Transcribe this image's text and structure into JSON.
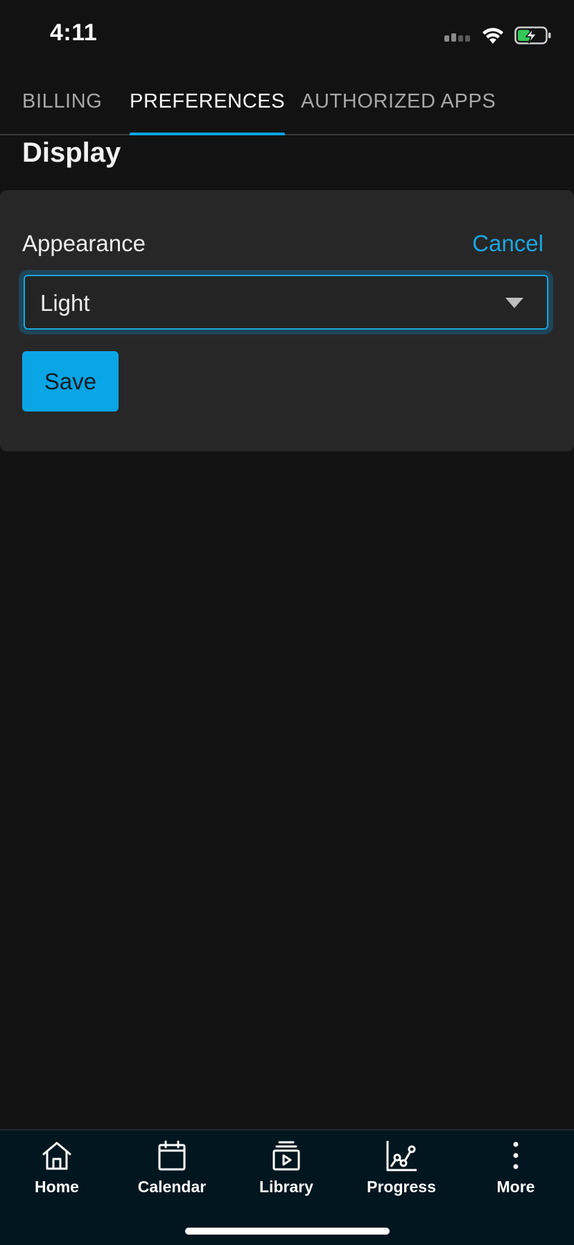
{
  "status_bar": {
    "time": "4:11"
  },
  "tabs": [
    {
      "label": "BILLING",
      "active": false
    },
    {
      "label": "PREFERENCES",
      "active": true
    },
    {
      "label": "AUTHORIZED APPS",
      "active": false
    }
  ],
  "section": {
    "title": "Display"
  },
  "card": {
    "label": "Appearance",
    "cancel_label": "Cancel",
    "select_value": "Light",
    "save_label": "Save"
  },
  "bottom_nav": [
    {
      "label": "Home",
      "icon": "home-icon"
    },
    {
      "label": "Calendar",
      "icon": "calendar-icon"
    },
    {
      "label": "Library",
      "icon": "library-icon"
    },
    {
      "label": "Progress",
      "icon": "progress-icon"
    },
    {
      "label": "More",
      "icon": "more-icon"
    }
  ],
  "colors": {
    "accent": "#0aa5e4",
    "background": "#121212",
    "card": "#272727",
    "nav_background": "#02161f",
    "battery_green": "#34c759"
  }
}
